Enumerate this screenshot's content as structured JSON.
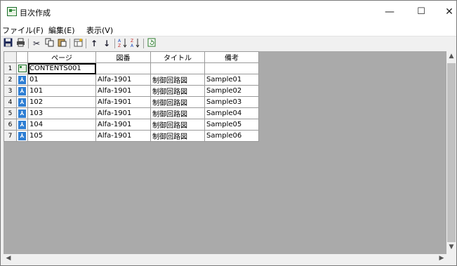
{
  "window": {
    "title": "目次作成",
    "minimize": "—",
    "maximize": "☐",
    "close": "✕"
  },
  "menu": {
    "items": [
      "ファイル(F)",
      "編集(E)",
      "表示(V)"
    ]
  },
  "toolbar": {
    "icons": [
      "save-icon",
      "print-icon",
      "cut-icon",
      "copy-icon",
      "paste-icon",
      "insert-icon",
      "move-up-icon",
      "move-down-icon",
      "sort-ascending-icon",
      "sort-descending-icon",
      "refresh-icon"
    ]
  },
  "table": {
    "columns": [
      "ページ",
      "図番",
      "タイトル",
      "備考"
    ],
    "rows": [
      {
        "num": "1",
        "icon": "toc-icon",
        "page": "CONTENTS001",
        "zuban": "",
        "title": "",
        "note": ""
      },
      {
        "num": "2",
        "icon": "pdf-icon",
        "page": "01",
        "zuban": "Alfa-1901",
        "title": "制御回路図",
        "note": "Sample01"
      },
      {
        "num": "3",
        "icon": "pdf-icon",
        "page": "101",
        "zuban": "Alfa-1901",
        "title": "制御回路図",
        "note": "Sample02"
      },
      {
        "num": "4",
        "icon": "pdf-icon",
        "page": "102",
        "zuban": "Alfa-1901",
        "title": "制御回路図",
        "note": "Sample03"
      },
      {
        "num": "5",
        "icon": "pdf-icon",
        "page": "103",
        "zuban": "Alfa-1901",
        "title": "制御回路図",
        "note": "Sample04"
      },
      {
        "num": "6",
        "icon": "pdf-icon",
        "page": "104",
        "zuban": "Alfa-1901",
        "title": "制御回路図",
        "note": "Sample05"
      },
      {
        "num": "7",
        "icon": "pdf-icon",
        "page": "105",
        "zuban": "Alfa-1901",
        "title": "制御回路図",
        "note": "Sample06"
      }
    ]
  }
}
